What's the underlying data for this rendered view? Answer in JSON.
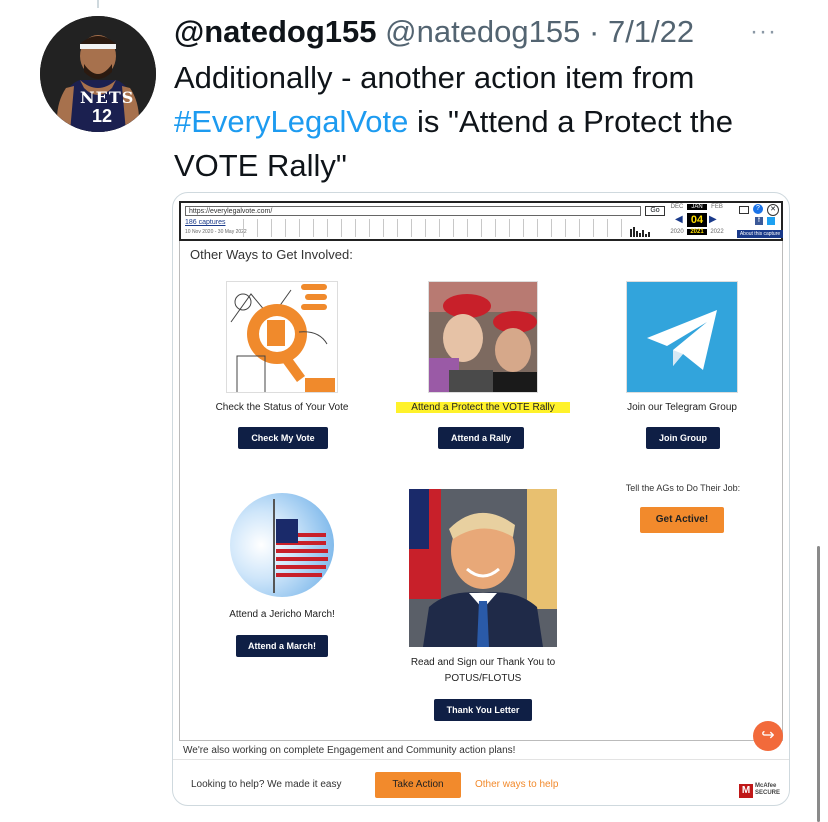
{
  "tweet": {
    "display_name": "@natedog155",
    "handle": "@natedog155",
    "separator": "·",
    "date": "7/1/22",
    "more_glyph": "···",
    "text_before": "Additionally - another action item from ",
    "hashtag": "#EveryLegalVote",
    "text_after": " is \"Attend a Protect the VOTE Rally\"",
    "avatar_team_text": "NETS",
    "avatar_number": "12",
    "link_color": "#1d9bf0"
  },
  "wayback": {
    "url": "https://everylegalvote.com/",
    "go_label": "Go",
    "captures": "186 captures",
    "range": "10 Nov 2020 - 30 May 2022",
    "months": [
      "DEC",
      "JAN",
      "FEB"
    ],
    "day": "04",
    "years": [
      "2020",
      "2021",
      "2022"
    ],
    "about": "About this capture"
  },
  "page": {
    "heading": "Other Ways to Get Involved:",
    "cards": [
      {
        "title": "Check the Status of Your Vote",
        "button": "Check My Vote"
      },
      {
        "title": "Attend a Protect the VOTE Rally",
        "button": "Attend a Rally"
      },
      {
        "title": "Join our Telegram Group",
        "button": "Join Group"
      },
      {
        "title": "Tell the AGs to Do Their Job:",
        "button": "Get Active!"
      },
      {
        "title": "Attend a Jericho March!",
        "button": "Attend a March!"
      },
      {
        "title_line1": "Read and Sign our Thank You to",
        "title_line2": "POTUS/FLOTUS",
        "button": "Thank You Letter"
      }
    ],
    "engagement": "We're also working on complete Engagement and Community action plans!",
    "bottom_text": "Looking to help? We made it easy",
    "take_action": "Take Action",
    "other_ways": "Other ways to help",
    "mcafee_line1": "McAfee",
    "mcafee_line2": "SECURE",
    "colors": {
      "navy_button": "#0f1f45",
      "orange_button": "#f28a2c",
      "highlight": "#fff22a",
      "telegram_blue": "#32a4dc"
    }
  }
}
